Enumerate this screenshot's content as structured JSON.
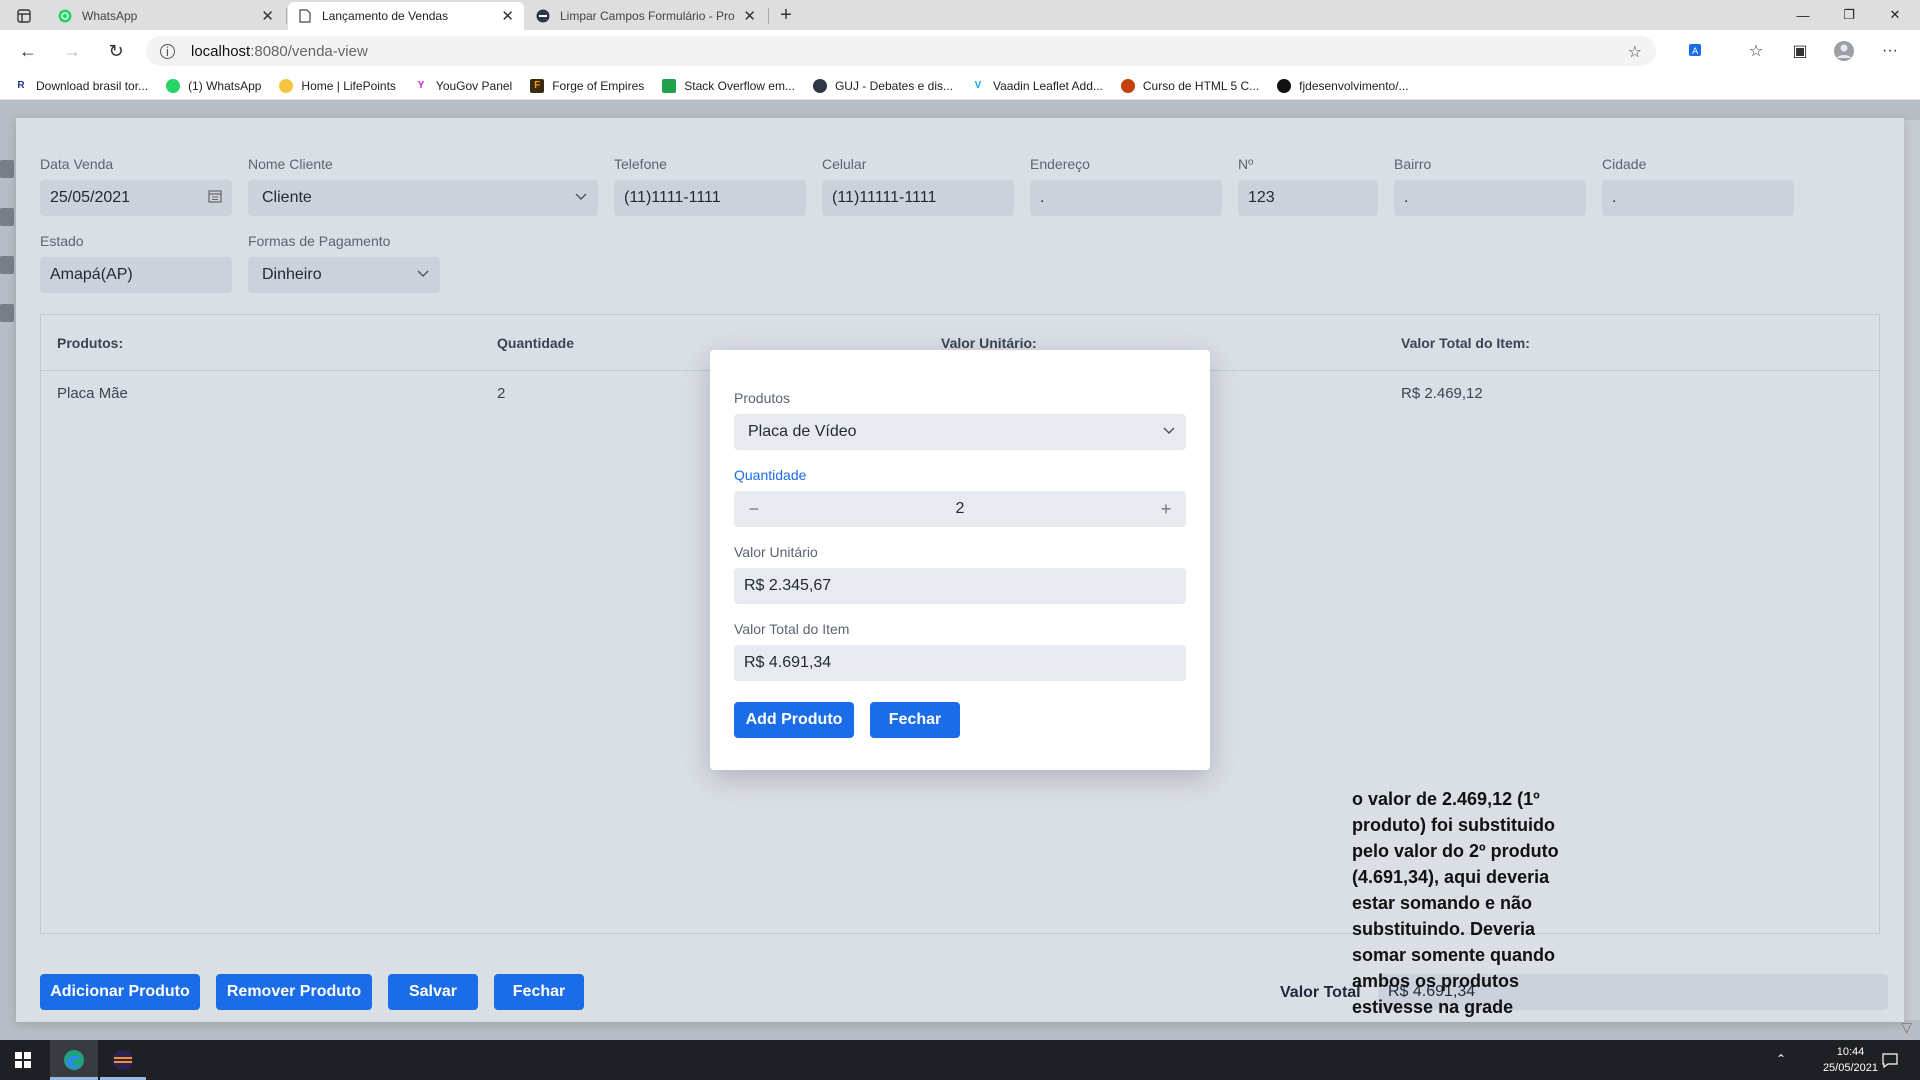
{
  "browser": {
    "tabs": [
      {
        "title": "WhatsApp",
        "icon": "whatsapp-icon"
      },
      {
        "title": "Lançamento de Vendas",
        "icon": "page-icon"
      },
      {
        "title": "Limpar Campos Formulário - Pro",
        "icon": "site-icon"
      }
    ],
    "url_host": "localhost",
    "url_path": ":8080/venda-view",
    "bookmarks": [
      "Download brasil tor...",
      "(1) WhatsApp",
      "Home | LifePoints",
      "YouGov Panel",
      "Forge of Empires",
      "Stack Overflow em...",
      "GUJ - Debates e dis...",
      "Vaadin Leaflet Add...",
      "Curso de HTML 5 C...",
      "fjdesenvolvimento/..."
    ]
  },
  "form": {
    "data_venda": {
      "label": "Data Venda",
      "value": "25/05/2021"
    },
    "nome_cliente": {
      "label": "Nome Cliente",
      "value": "Cliente"
    },
    "telefone": {
      "label": "Telefone",
      "value": "(11)1111-1111"
    },
    "celular": {
      "label": "Celular",
      "value": "(11)11111-1111"
    },
    "endereco": {
      "label": "Endereço",
      "value": "."
    },
    "numero": {
      "label": "Nº",
      "value": "123"
    },
    "bairro": {
      "label": "Bairro",
      "value": "."
    },
    "cidade": {
      "label": "Cidade",
      "value": "."
    },
    "estado": {
      "label": "Estado",
      "value": "Amapá(AP)"
    },
    "pagamento": {
      "label": "Formas de Pagamento",
      "value": "Dinheiro"
    }
  },
  "grid": {
    "headers": [
      "Produtos:",
      "Quantidade",
      "Valor Unitário:",
      "Valor Total do Item:"
    ],
    "rows": [
      {
        "produto": "Placa Mãe",
        "quantidade": "2",
        "valor_total": "R$ 2.469,12"
      }
    ]
  },
  "buttons": {
    "adicionar": "Adicionar Produto",
    "remover": "Remover Produto",
    "salvar": "Salvar",
    "fechar": "Fechar"
  },
  "total": {
    "label": "Valor Total",
    "value": "R$ 4.691,34"
  },
  "modal": {
    "produtos": {
      "label": "Produtos",
      "value": "Placa de Vídeo"
    },
    "quantidade": {
      "label": "Quantidade",
      "value": "2"
    },
    "valor_unitario": {
      "label": "Valor Unitário",
      "value": "R$ 2.345,67"
    },
    "valor_total": {
      "label": "Valor Total do Item",
      "value": "R$ 4.691,34"
    },
    "add_button": "Add Produto",
    "fechar_button": "Fechar"
  },
  "annotation": "o valor de 2.469,12 (1º produto) foi substituido pelo valor do 2º produto (4.691,34), aqui deveria estar somando e não substituindo. Deveria somar somente quando ambos os produtos estivesse na grade",
  "taskbar": {
    "time": "10:44",
    "date": "25/05/2021"
  },
  "colors": {
    "accent": "#1a6ce8",
    "field_bg": "#ccd2db"
  }
}
